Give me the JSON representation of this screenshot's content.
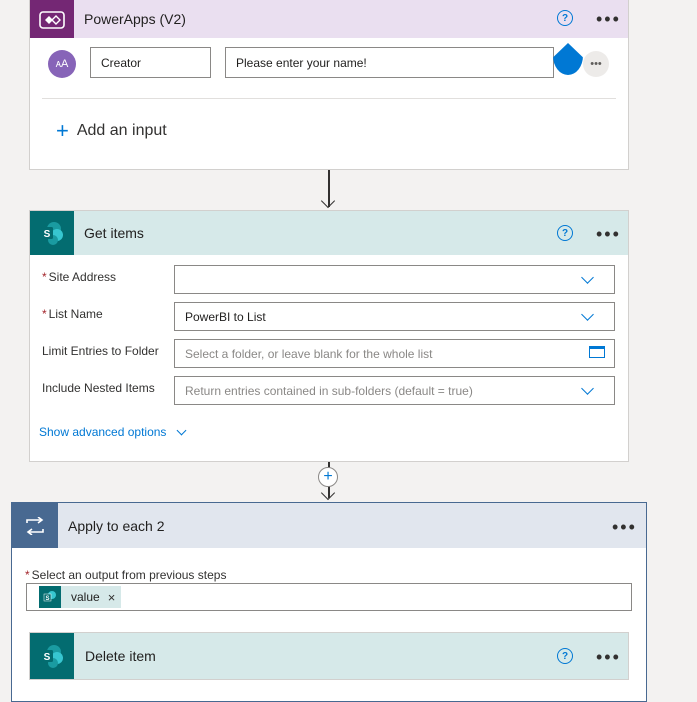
{
  "powerapps": {
    "title": "PowerApps (V2)",
    "input_avatar": "ᴀA",
    "input_name": "Creator",
    "input_prompt": "Please enter your name!",
    "add_input_label": "Add an input",
    "colors": {
      "header_bg": "#eadff0",
      "icon_bg": "#742774"
    }
  },
  "get_items": {
    "title": "Get items",
    "site_address_label": "Site Address",
    "site_address_value": "",
    "list_name_label": "List Name",
    "list_name_value": "PowerBI to List",
    "limit_label": "Limit Entries to Folder",
    "limit_placeholder": "Select a folder, or leave blank for the whole list",
    "nested_label": "Include Nested Items",
    "nested_placeholder": "Return entries contained in sub-folders (default = true)",
    "advanced_label": "Show advanced options",
    "colors": {
      "header_bg": "#d6e9e9",
      "icon_bg": "#036c70"
    }
  },
  "apply_each": {
    "title": "Apply to each 2",
    "output_label": "Select an output from previous steps",
    "token_label": "value",
    "token_remove": "×",
    "colors": {
      "header_bg": "#e1e6ee",
      "icon_bg": "#486991",
      "border": "#486991"
    }
  },
  "delete_item": {
    "title": "Delete item"
  }
}
